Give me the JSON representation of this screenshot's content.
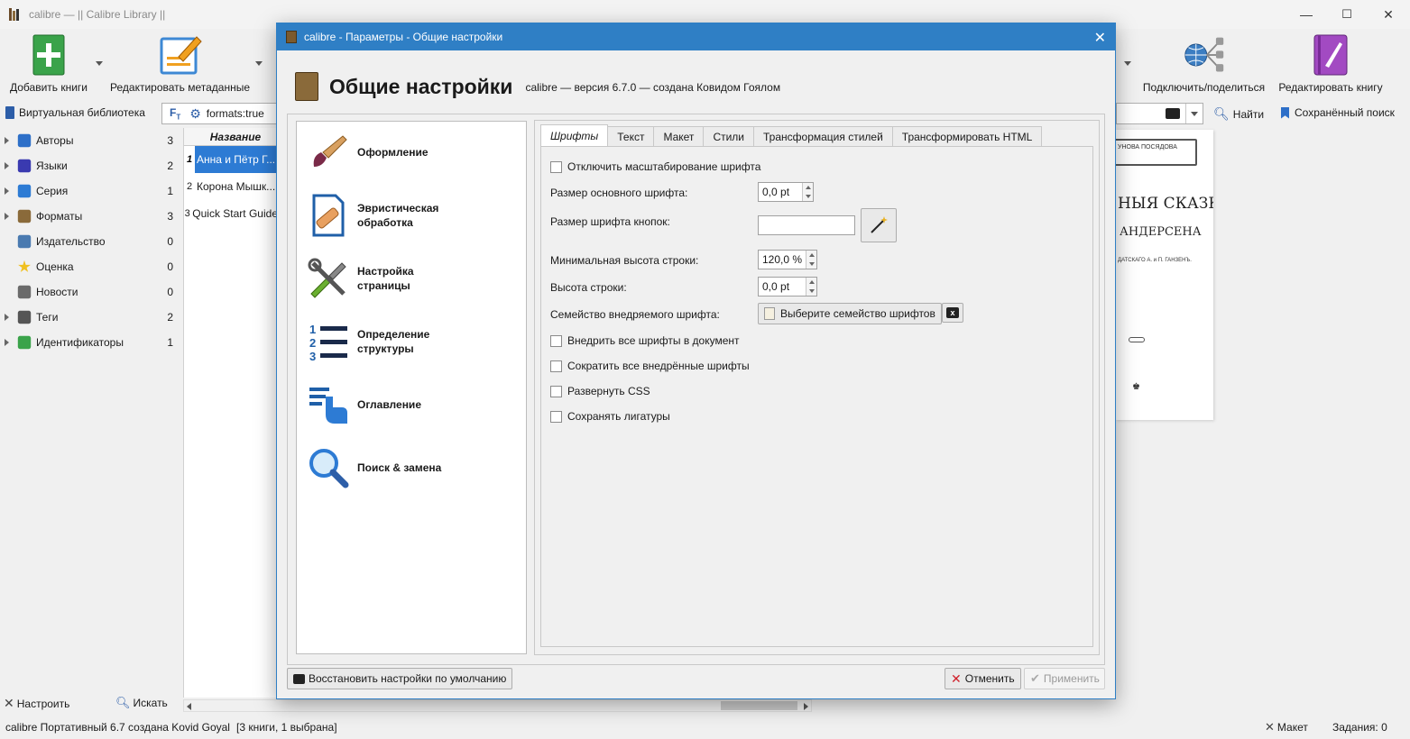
{
  "main_window": {
    "title": "calibre — || Calibre Library ||",
    "min_symbol": "—",
    "max_symbol": "☐",
    "close_symbol": "✕"
  },
  "toolbar": {
    "add_books": "Добавить книги",
    "edit_metadata": "Редактировать метаданные",
    "connect_share": "Подключить/поделиться",
    "edit_book": "Редактировать книгу"
  },
  "searchbar": {
    "virtual_library": "Виртуальная библиотека",
    "search_value": "formats:true",
    "find": "Найти",
    "saved_search": "Сохранённый поиск"
  },
  "tag_browser": [
    {
      "label": "Авторы",
      "count": "3",
      "expandable": true,
      "icon": "authors-icon"
    },
    {
      "label": "Языки",
      "count": "2",
      "expandable": true,
      "icon": "languages-icon"
    },
    {
      "label": "Серия",
      "count": "1",
      "expandable": true,
      "icon": "series-icon"
    },
    {
      "label": "Форматы",
      "count": "3",
      "expandable": true,
      "icon": "formats-icon"
    },
    {
      "label": "Издательство",
      "count": "0",
      "expandable": false,
      "icon": "publisher-icon"
    },
    {
      "label": "Оценка",
      "count": "0",
      "expandable": false,
      "icon": "rating-icon"
    },
    {
      "label": "Новости",
      "count": "0",
      "expandable": false,
      "icon": "news-icon"
    },
    {
      "label": "Теги",
      "count": "2",
      "expandable": true,
      "icon": "tags-icon"
    },
    {
      "label": "Идентификаторы",
      "count": "1",
      "expandable": true,
      "icon": "identifiers-icon"
    }
  ],
  "book_list": {
    "header": "Название",
    "rows": [
      {
        "num": "1",
        "title": "Анна и Пётр Г...",
        "selected": true
      },
      {
        "num": "2",
        "title": "Корона Мышк...",
        "selected": false
      },
      {
        "num": "3",
        "title": "Quick Start Guide",
        "selected": false
      }
    ]
  },
  "bottom_left": {
    "configure": "Настроить",
    "search": "Искать"
  },
  "statusbar": {
    "left": "calibre Портативный 6.7 создана Kovid Goyal",
    "count": "[3 книги, 1 выбрана]",
    "layout": "Макет",
    "jobs": "Задания: 0"
  },
  "cover": {
    "line1": "УНОВА ПОСЯДОВА",
    "line2": "НЫЯ СКАЗКИ",
    "line3": "АНДЕРСЕНА",
    "line4": "ДАТСКАГО А. и П. ГАНЗЕНЪ."
  },
  "dialog": {
    "title": "calibre - Параметры - Общие настройки",
    "close_symbol": "✕",
    "heading": "Общие настройки",
    "version": "calibre — версия 6.7.0 — создана Ковидом Гоялом",
    "categories": [
      {
        "label": "Оформление",
        "selected": true,
        "icon": "brush-icon"
      },
      {
        "label": "Эвристическая обработка",
        "selected": false,
        "icon": "bandage-icon"
      },
      {
        "label": "Настройка страницы",
        "selected": false,
        "icon": "tools-icon"
      },
      {
        "label": "Определение структуры",
        "selected": false,
        "icon": "numbered-list-icon"
      },
      {
        "label": "Оглавление",
        "selected": false,
        "icon": "toc-icon"
      },
      {
        "label": "Поиск & замена",
        "selected": false,
        "icon": "magnifier-icon"
      }
    ],
    "tabs": [
      "Шрифты",
      "Текст",
      "Макет",
      "Стили",
      "Трансформация стилей",
      "Трансформировать HTML"
    ],
    "active_tab": "Шрифты",
    "form": {
      "disable_font_scaling": "Отключить масштабирование шрифта",
      "base_font_size_label": "Размер основного шрифта:",
      "base_font_size_value": "0,0 pt",
      "font_key_label": "Размер шрифта кнопок:",
      "font_key_value": "",
      "min_line_height_label": "Минимальная высота строки:",
      "min_line_height_value": "120,0 %",
      "line_height_label": "Высота строки:",
      "line_height_value": "0,0 pt",
      "embed_font_family_label": "Семейство внедряемого шрифта:",
      "embed_font_family_button": "Выберите семейство шрифтов",
      "embed_all_fonts": "Внедрить все шрифты в документ",
      "subset_fonts": "Сократить все внедрённые шрифты",
      "expand_css": "Развернуть CSS",
      "keep_ligatures": "Сохранять лигатуры"
    },
    "restore_defaults": "Восстановить настройки по умолчанию",
    "cancel": "Отменить",
    "apply": "Применить"
  }
}
